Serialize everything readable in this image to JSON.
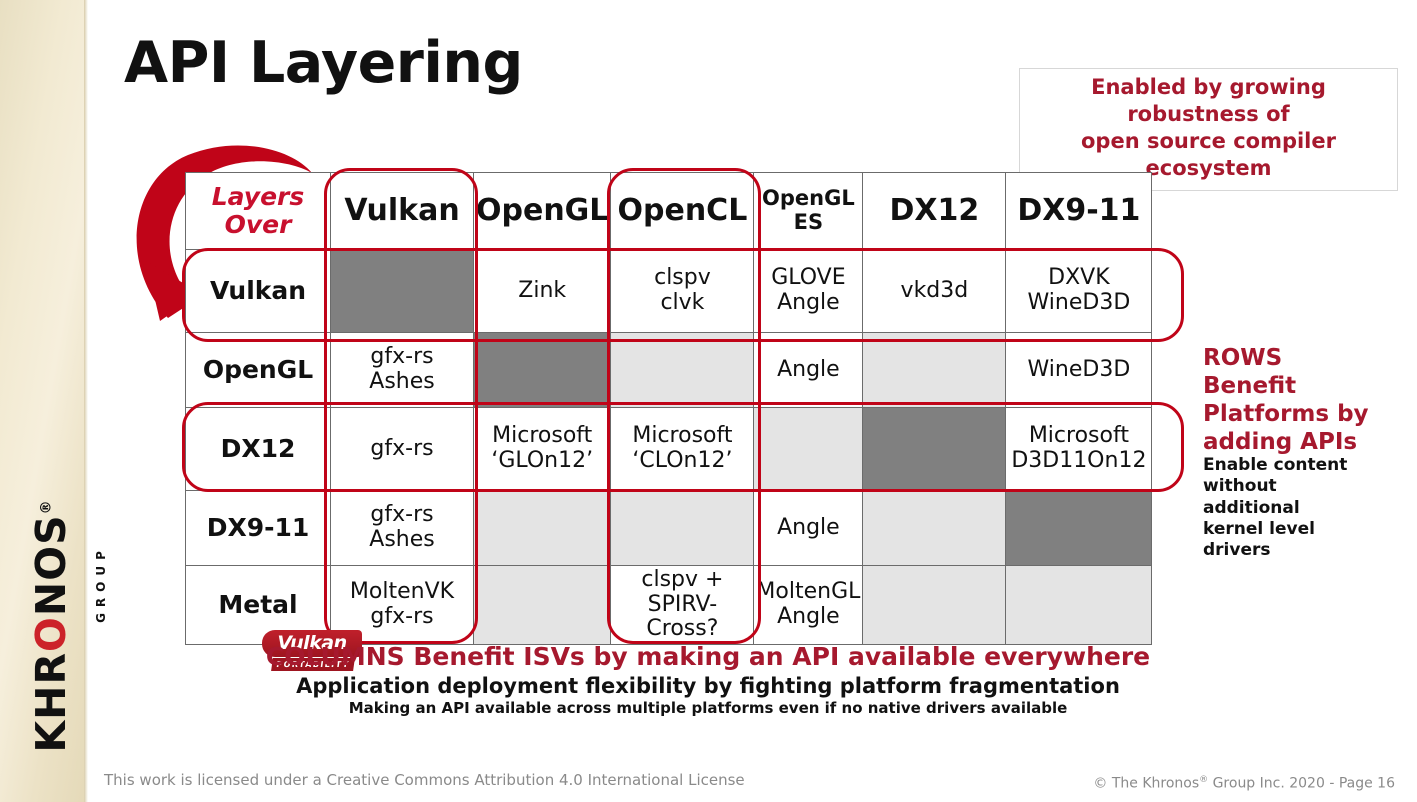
{
  "slide": {
    "title": "API Layering",
    "callout": {
      "line1": "Enabled by growing robustness of",
      "line2": "open source compiler ecosystem",
      "color": "#a6192e"
    },
    "brand": {
      "logo_word_1": "KHR",
      "logo_word_o": "O",
      "logo_word_2": "NOS",
      "registered": "®",
      "logo_sub": "GROUP",
      "accent_red": "#cc2229",
      "stripe_color": "#f2ead2"
    },
    "arrow": {
      "name": "curved-red-arrow",
      "color": "#c00418"
    }
  },
  "table": {
    "corner_label_line1": "Layers",
    "corner_label_line2": "Over",
    "columns": [
      "Vulkan",
      "OpenGL",
      "OpenCL",
      "OpenGL ES",
      "DX12",
      "DX9-11"
    ],
    "rows": [
      {
        "label": "Vulkan",
        "cells": [
          {
            "text": "",
            "state": "self"
          },
          {
            "text": "Zink",
            "state": "filled"
          },
          {
            "text": "clspv\nclvk",
            "state": "filled"
          },
          {
            "text": "GLOVE\nAngle",
            "state": "filled"
          },
          {
            "text": "vkd3d",
            "state": "filled"
          },
          {
            "text": "DXVK\nWineD3D",
            "state": "filled"
          }
        ]
      },
      {
        "label": "OpenGL",
        "cells": [
          {
            "text": "gfx-rs\nAshes",
            "state": "filled"
          },
          {
            "text": "",
            "state": "self"
          },
          {
            "text": "",
            "state": "empty"
          },
          {
            "text": "Angle",
            "state": "filled"
          },
          {
            "text": "",
            "state": "empty"
          },
          {
            "text": "WineD3D",
            "state": "filled"
          }
        ]
      },
      {
        "label": "DX12",
        "cells": [
          {
            "text": "gfx-rs",
            "state": "filled"
          },
          {
            "text": "Microsoft\n‘GLOn12’",
            "state": "filled"
          },
          {
            "text": "Microsoft\n‘CLOn12’",
            "state": "filled"
          },
          {
            "text": "",
            "state": "empty"
          },
          {
            "text": "",
            "state": "self"
          },
          {
            "text": "Microsoft\nD3D11On12",
            "state": "filled"
          }
        ]
      },
      {
        "label": "DX9-11",
        "cells": [
          {
            "text": "gfx-rs\nAshes",
            "state": "filled"
          },
          {
            "text": "",
            "state": "empty"
          },
          {
            "text": "",
            "state": "empty"
          },
          {
            "text": "Angle",
            "state": "filled"
          },
          {
            "text": "",
            "state": "empty"
          },
          {
            "text": "",
            "state": "self"
          }
        ]
      },
      {
        "label": "Metal",
        "cells": [
          {
            "text": "MoltenVK\ngfx-rs",
            "state": "filled"
          },
          {
            "text": "",
            "state": "empty"
          },
          {
            "text": "clspv +\nSPIRV-Cross?",
            "state": "filled"
          },
          {
            "text": "MoltenGL\nAngle",
            "state": "filled"
          },
          {
            "text": "",
            "state": "empty"
          },
          {
            "text": "",
            "state": "empty"
          }
        ]
      }
    ],
    "highlights": {
      "columns": [
        "Vulkan",
        "OpenCL"
      ],
      "rows": [
        "Vulkan",
        "DX12"
      ],
      "color": "#c00418"
    },
    "colors": {
      "self_cell": "#808080",
      "empty_cell": "#e4e4e4",
      "grid_line": "#6b6b6b",
      "corner_label": "#c8102e"
    }
  },
  "rows_note": {
    "heading": "ROWS\nBenefit\nPlatforms by\nadding APIs",
    "heading_line1": "ROWS",
    "heading_line2": "Benefit",
    "heading_line3": "Platforms by",
    "heading_line4": "adding APIs",
    "sub_line1": "Enable content",
    "sub_line2": "without additional",
    "sub_line3": "kernel level",
    "sub_line4": "drivers"
  },
  "vulkan_portability": {
    "name": "Vulkan",
    "sub": "PORTABILITY"
  },
  "captions": {
    "line1": "COLUMNS Benefit ISVs by making an API available everywhere",
    "line2": "Application deployment flexibility by fighting platform fragmentation",
    "line3": "Making an API available across multiple platforms even if no native drivers available"
  },
  "footer": {
    "license": "This work is licensed under a Creative Commons Attribution 4.0 International License",
    "copyright_pre": "© The Khronos",
    "copyright_sup": "®",
    "copyright_post": " Group Inc. 2020 - Page 16"
  }
}
